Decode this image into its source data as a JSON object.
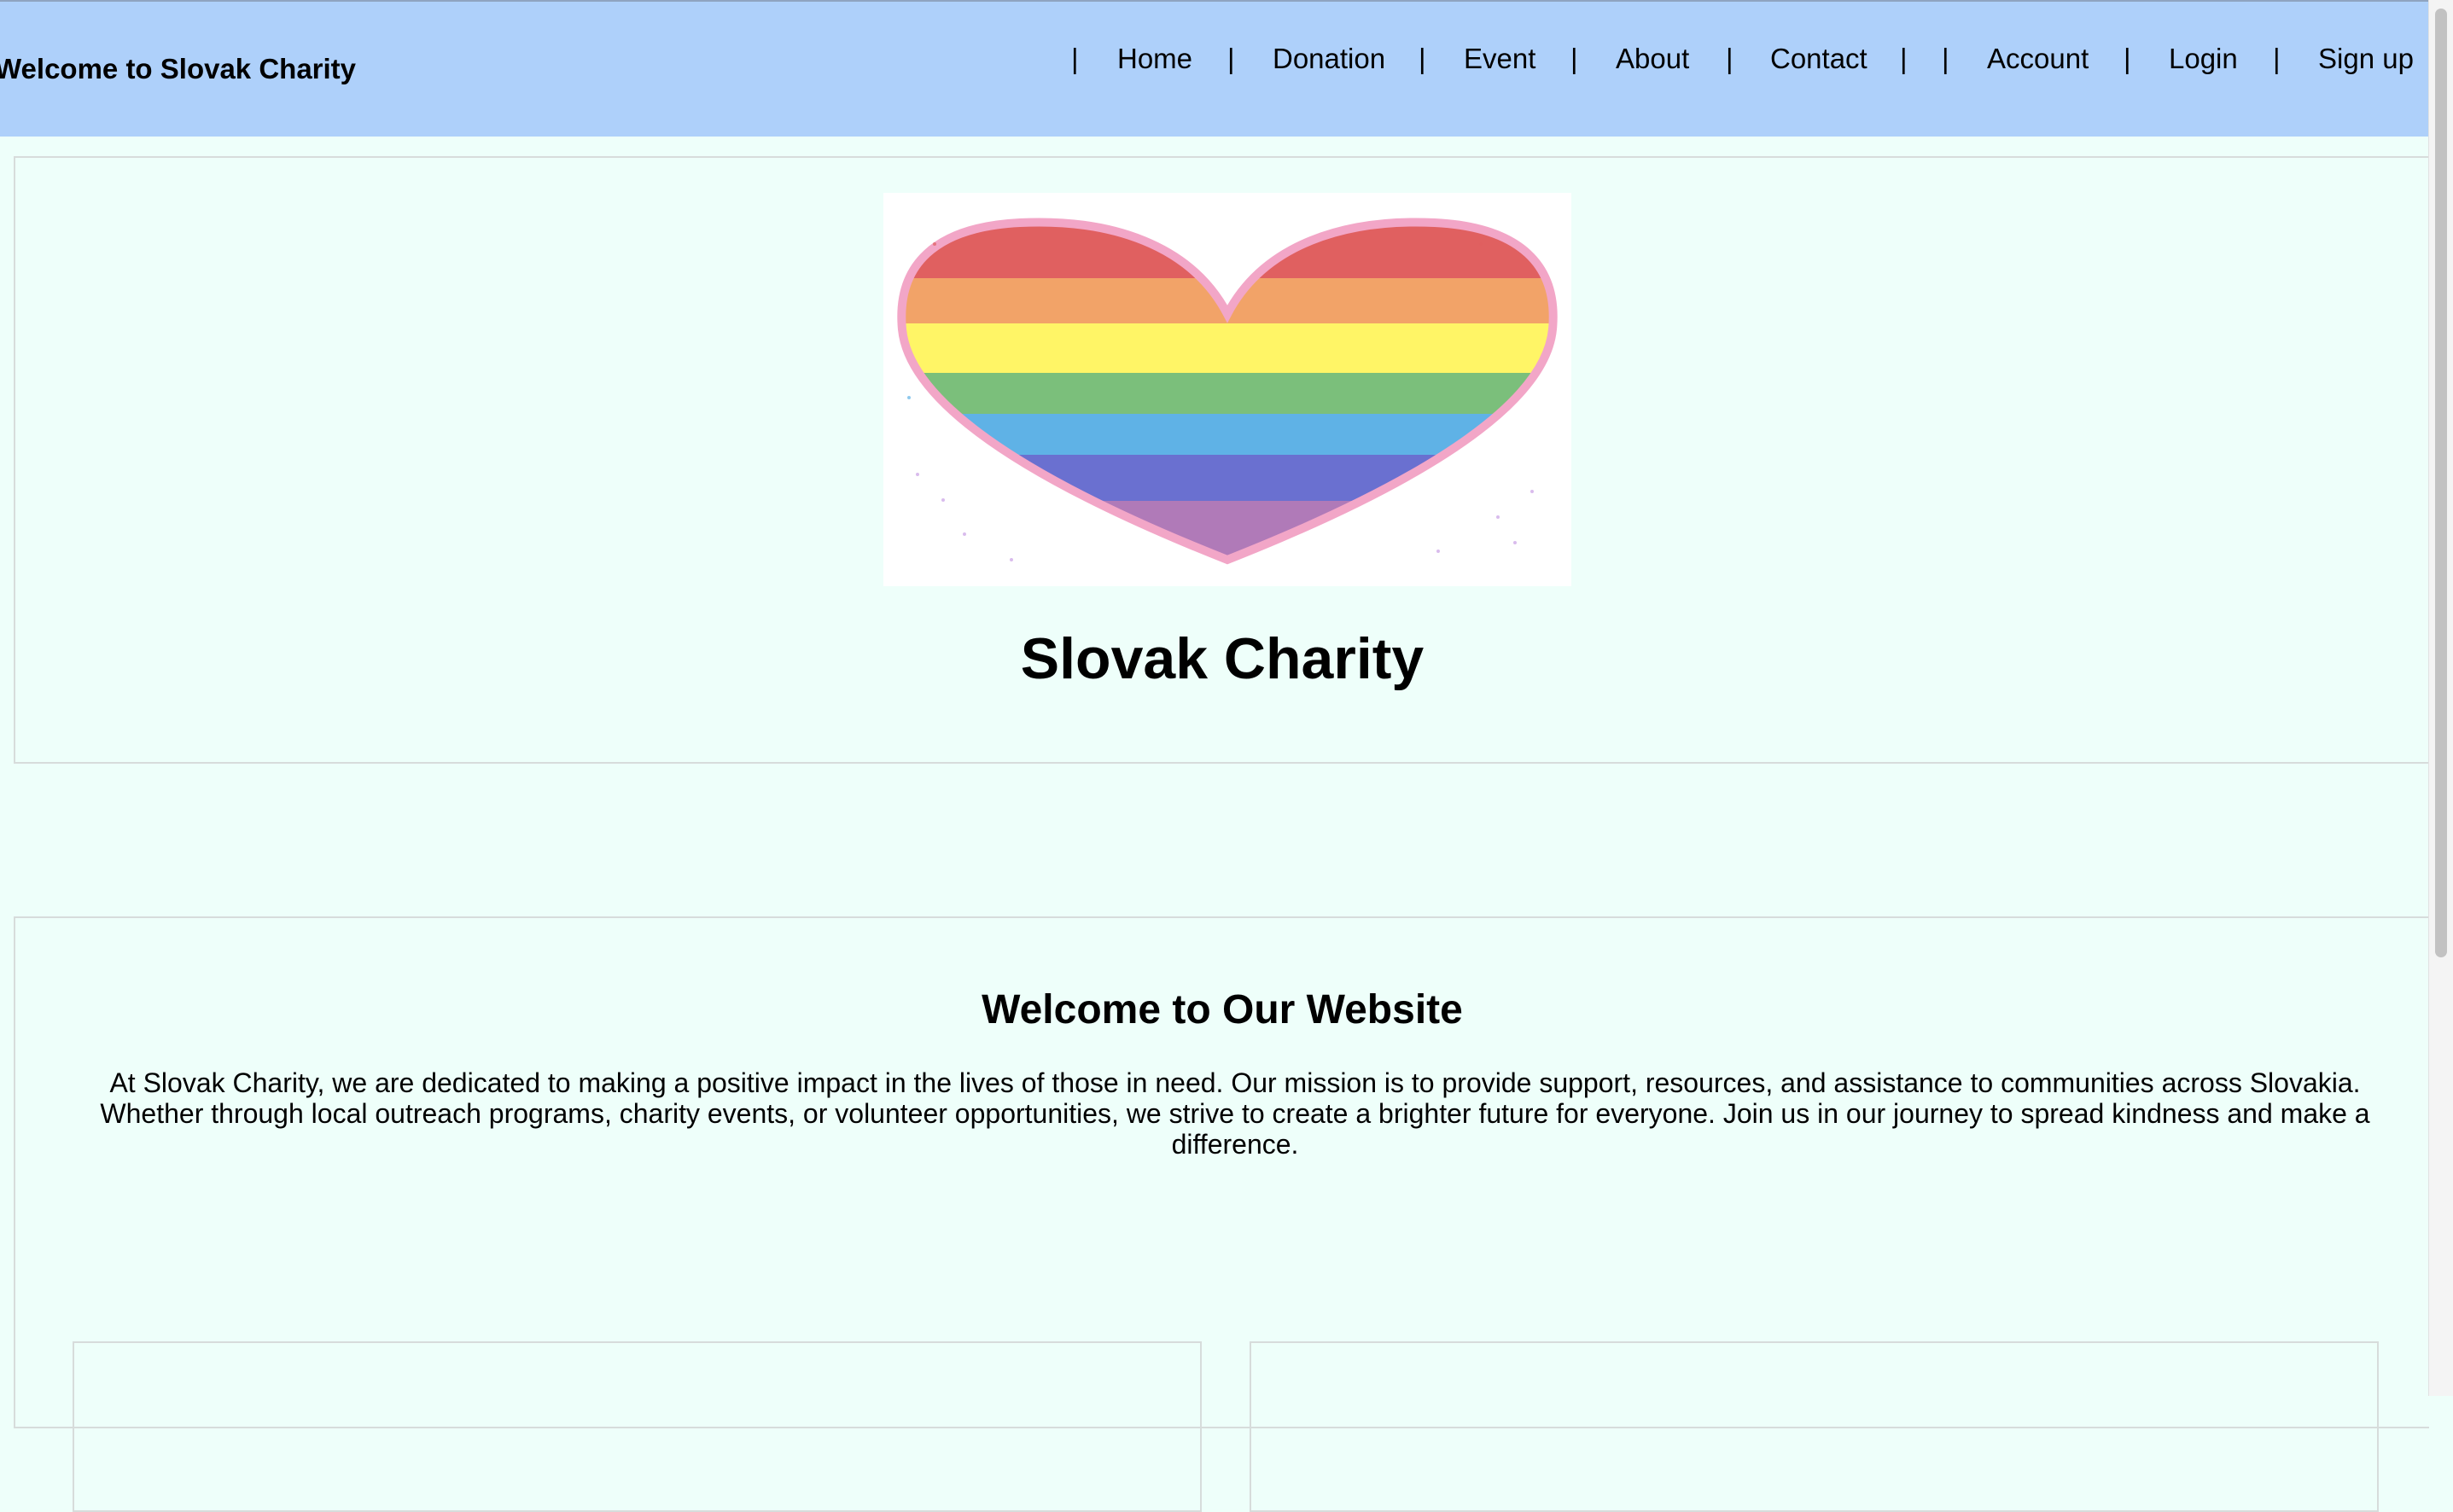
{
  "header": {
    "brand": "Welcome to Slovak Charity",
    "separator": "|",
    "nav": [
      {
        "label": "Home"
      },
      {
        "label": "Donation"
      },
      {
        "label": "Event"
      },
      {
        "label": "About"
      },
      {
        "label": "Contact"
      },
      {
        "label": "Account"
      },
      {
        "label": "Login"
      },
      {
        "label": "Sign up"
      }
    ]
  },
  "hero": {
    "image": "rainbow-heart-image",
    "title": "Slovak Charity"
  },
  "welcome": {
    "title": "Welcome to Our Website",
    "text": "At Slovak Charity, we are dedicated to making a positive impact in the lives of those in need. Our mission is to provide support, resources, and assistance to communities across Slovakia. Whether through local outreach programs, charity events, or volunteer opportunities, we strive to create a brighter future for everyone. Join us in our journey to spread kindness and make a difference."
  },
  "colors": {
    "header_bg": "#aed0fa",
    "page_bg": "#eefffa",
    "heart_outline": "#f2a6c7",
    "rainbow": [
      "#e06060",
      "#f2a368",
      "#fff566",
      "#7bbf7b",
      "#5fb2e6",
      "#6a70d0",
      "#b07ab8"
    ]
  }
}
